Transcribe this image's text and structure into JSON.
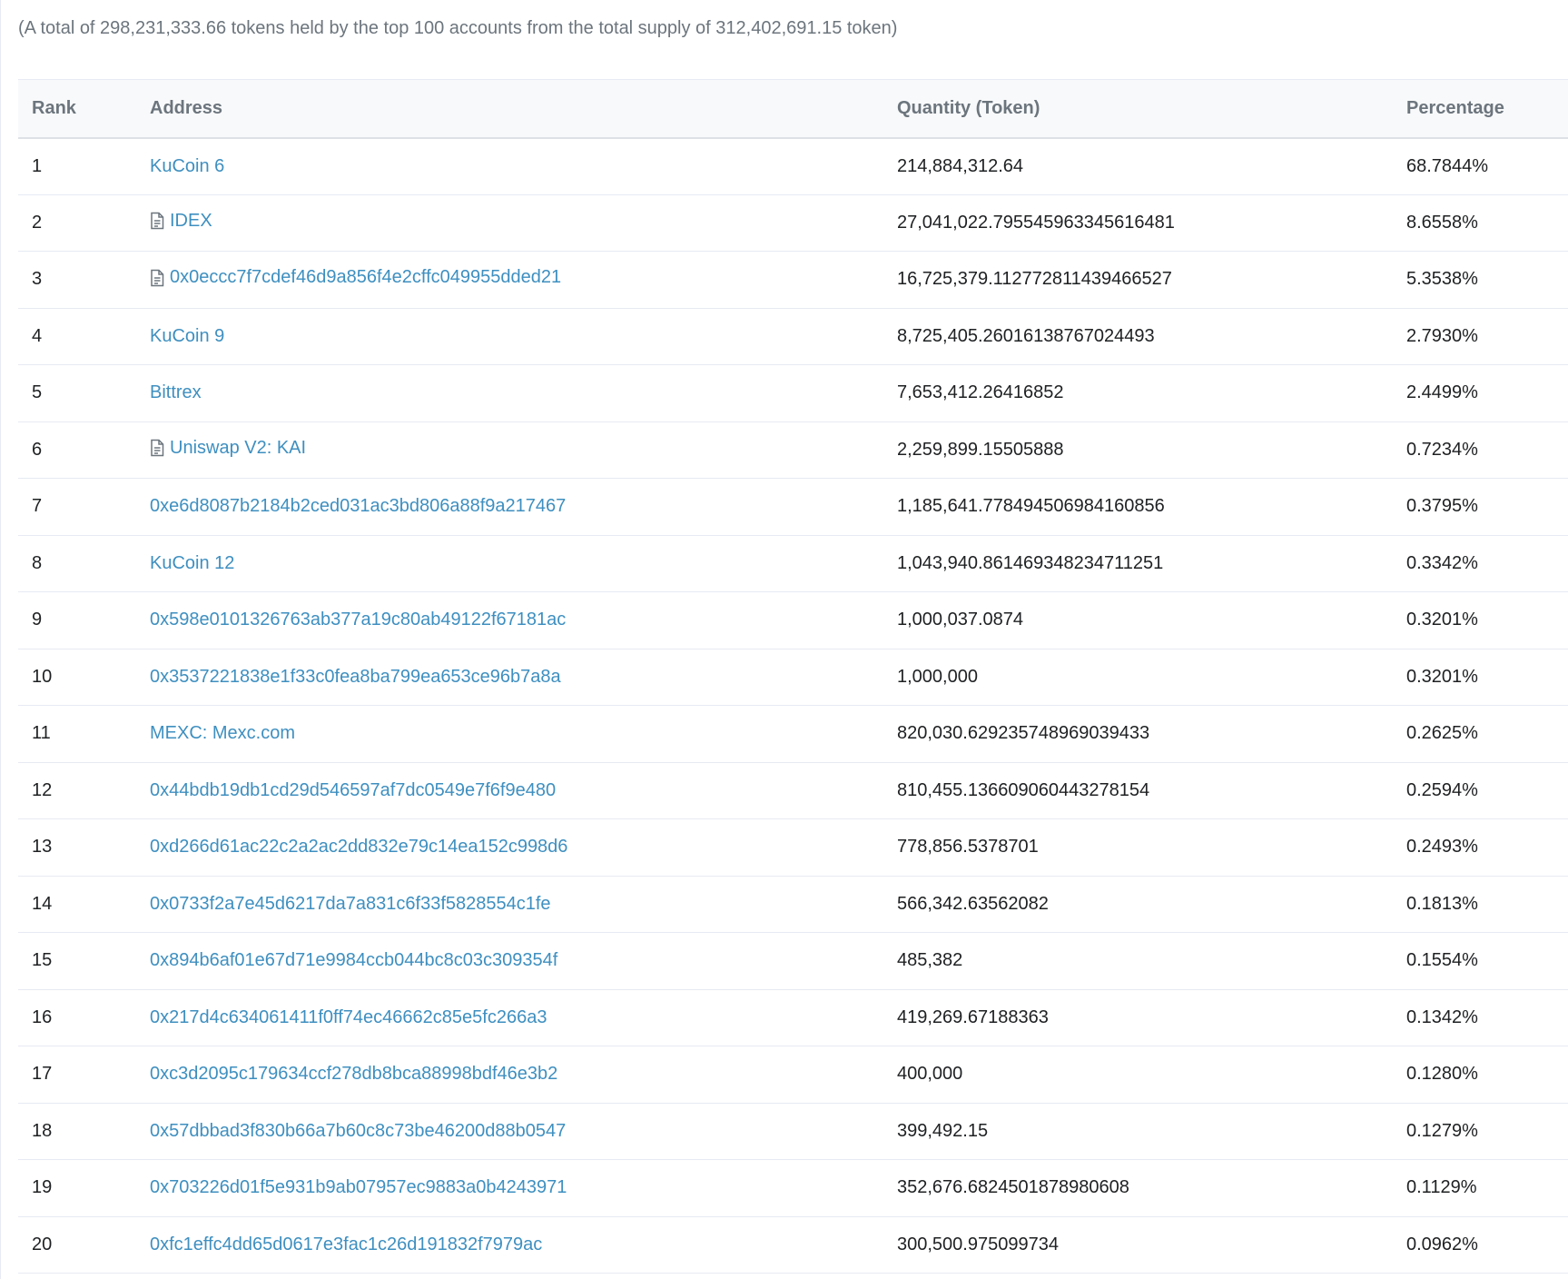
{
  "summary": "(A total of 298,231,333.66 tokens held by the top 100 accounts from the total supply of 312,402,691.15 token)",
  "table": {
    "headers": {
      "rank": "Rank",
      "address": "Address",
      "quantity": "Quantity (Token)",
      "percentage": "Percentage"
    },
    "rows": [
      {
        "rank": "1",
        "address": "KuCoin 6",
        "contract": false,
        "quantity": "214,884,312.64",
        "percentage": "68.7844%"
      },
      {
        "rank": "2",
        "address": "IDEX",
        "contract": true,
        "quantity": "27,041,022.795545963345616481",
        "percentage": "8.6558%"
      },
      {
        "rank": "3",
        "address": "0x0eccc7f7cdef46d9a856f4e2cffc049955dded21",
        "contract": true,
        "quantity": "16,725,379.112772811439466527",
        "percentage": "5.3538%"
      },
      {
        "rank": "4",
        "address": "KuCoin 9",
        "contract": false,
        "quantity": "8,725,405.26016138767024493",
        "percentage": "2.7930%"
      },
      {
        "rank": "5",
        "address": "Bittrex",
        "contract": false,
        "quantity": "7,653,412.26416852",
        "percentage": "2.4499%"
      },
      {
        "rank": "6",
        "address": "Uniswap V2: KAI",
        "contract": true,
        "quantity": "2,259,899.15505888",
        "percentage": "0.7234%"
      },
      {
        "rank": "7",
        "address": "0xe6d8087b2184b2ced031ac3bd806a88f9a217467",
        "contract": false,
        "quantity": "1,185,641.778494506984160856",
        "percentage": "0.3795%"
      },
      {
        "rank": "8",
        "address": "KuCoin 12",
        "contract": false,
        "quantity": "1,043,940.861469348234711251",
        "percentage": "0.3342%"
      },
      {
        "rank": "9",
        "address": "0x598e0101326763ab377a19c80ab49122f67181ac",
        "contract": false,
        "quantity": "1,000,037.0874",
        "percentage": "0.3201%"
      },
      {
        "rank": "10",
        "address": "0x3537221838e1f33c0fea8ba799ea653ce96b7a8a",
        "contract": false,
        "quantity": "1,000,000",
        "percentage": "0.3201%"
      },
      {
        "rank": "11",
        "address": "MEXC: Mexc.com",
        "contract": false,
        "quantity": "820,030.629235748969039433",
        "percentage": "0.2625%"
      },
      {
        "rank": "12",
        "address": "0x44bdb19db1cd29d546597af7dc0549e7f6f9e480",
        "contract": false,
        "quantity": "810,455.136609060443278154",
        "percentage": "0.2594%"
      },
      {
        "rank": "13",
        "address": "0xd266d61ac22c2a2ac2dd832e79c14ea152c998d6",
        "contract": false,
        "quantity": "778,856.5378701",
        "percentage": "0.2493%"
      },
      {
        "rank": "14",
        "address": "0x0733f2a7e45d6217da7a831c6f33f5828554c1fe",
        "contract": false,
        "quantity": "566,342.63562082",
        "percentage": "0.1813%"
      },
      {
        "rank": "15",
        "address": "0x894b6af01e67d71e9984ccb044bc8c03c309354f",
        "contract": false,
        "quantity": "485,382",
        "percentage": "0.1554%"
      },
      {
        "rank": "16",
        "address": "0x217d4c634061411f0ff74ec46662c85e5fc266a3",
        "contract": false,
        "quantity": "419,269.67188363",
        "percentage": "0.1342%"
      },
      {
        "rank": "17",
        "address": "0xc3d2095c179634ccf278db8bca88998bdf46e3b2",
        "contract": false,
        "quantity": "400,000",
        "percentage": "0.1280%"
      },
      {
        "rank": "18",
        "address": "0x57dbbad3f830b66a7b60c8c73be46200d88b0547",
        "contract": false,
        "quantity": "399,492.15",
        "percentage": "0.1279%"
      },
      {
        "rank": "19",
        "address": "0x703226d01f5e931b9ab07957ec9883a0b4243971",
        "contract": false,
        "quantity": "352,676.6824501878980608",
        "percentage": "0.1129%"
      },
      {
        "rank": "20",
        "address": "0xfc1effc4dd65d0617e3fac1c26d191832f7979ac",
        "contract": false,
        "quantity": "300,500.975099734",
        "percentage": "0.0962%"
      }
    ]
  },
  "icons": {
    "contract": "file-text-icon"
  },
  "colors": {
    "link": "#3e8fc0",
    "muted": "#6c757d",
    "border": "#e7eaf3",
    "header_bg": "#f8f9fa"
  }
}
